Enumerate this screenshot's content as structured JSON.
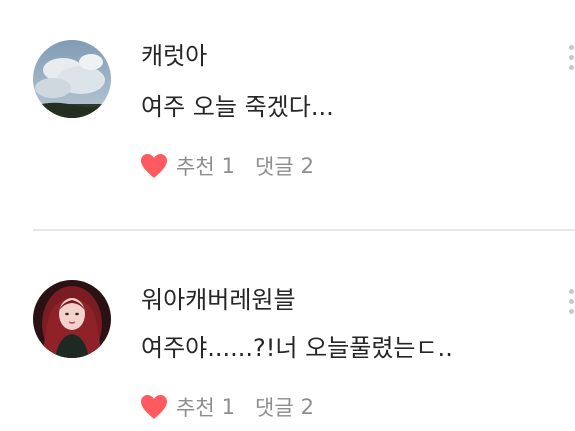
{
  "comments": [
    {
      "author": "캐럿아",
      "text": "여주 오늘 죽겠다...",
      "like_label": "추천",
      "like_count": "1",
      "reply_label": "댓글",
      "reply_count": "2",
      "avatar": "sky-clouds-avatar"
    },
    {
      "author": "워아캐버레원블",
      "text": "여주야......?!너 오늘풀렸는ㄷ..",
      "like_label": "추천",
      "like_count": "1",
      "reply_label": "댓글",
      "reply_count": "2",
      "avatar": "person-red-hair-avatar"
    }
  ],
  "icons": {
    "like": "heart-icon",
    "more": "more-vertical-icon"
  },
  "colors": {
    "heart": "#ff5a5f",
    "meta_text": "#8e8e8e",
    "divider": "#e6e6e6"
  }
}
